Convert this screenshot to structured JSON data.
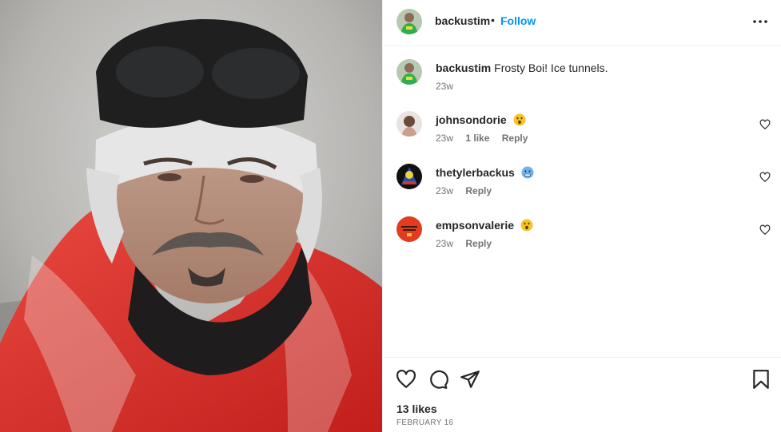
{
  "post": {
    "author": "backustim",
    "separator": "•",
    "follow_label": "Follow",
    "more_icon": "more-horizontal-icon",
    "caption": {
      "username": "backustim",
      "text": "Frosty Boi! Ice tunnels.",
      "time": "23w"
    },
    "likes": "13 likes",
    "date": "FEBRUARY 16"
  },
  "comments": [
    {
      "username": "johnsondorie",
      "emoji": "astonished-face",
      "time": "23w",
      "likes": "1 like",
      "reply": "Reply"
    },
    {
      "username": "thetylerbackus",
      "emoji": "cold-face",
      "time": "23w",
      "likes": "",
      "reply": "Reply"
    },
    {
      "username": "empsonvalerie",
      "emoji": "astonished-face",
      "time": "23w",
      "likes": "",
      "reply": "Reply"
    }
  ],
  "actions": [
    "heart-icon",
    "comment-icon",
    "share-icon",
    "bookmark-icon"
  ],
  "colors": {
    "link": "#0095f6",
    "text": "#262626",
    "muted": "#737373",
    "border": "#efefef"
  }
}
